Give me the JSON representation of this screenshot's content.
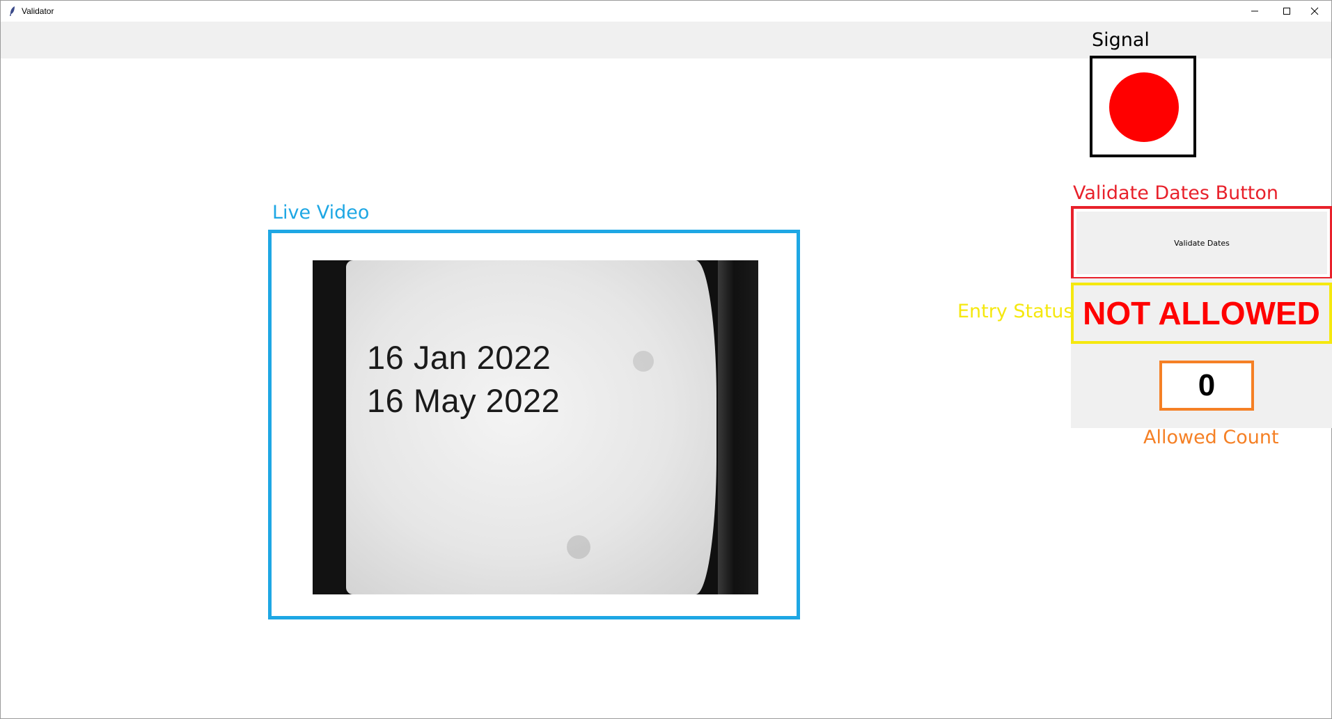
{
  "window": {
    "title": "Validator",
    "minimize_icon": "minimize-icon",
    "maximize_icon": "maximize-icon",
    "close_icon": "close-icon"
  },
  "signal": {
    "label": "Signal",
    "light_color": "#ff0000"
  },
  "video": {
    "label": "Live Video",
    "frame_color": "#1ea7e4",
    "feed_text": [
      "16 Jan 2022",
      "16 May 2022"
    ]
  },
  "validate": {
    "label": "Validate Dates Button",
    "button_label": "Validate Dates",
    "frame_color": "#e8212b"
  },
  "entry_status": {
    "label": "Entry Status",
    "value": "NOT ALLOWED",
    "value_color": "#ff0000",
    "frame_color": "#f5e80f"
  },
  "allowed_count": {
    "label": "Allowed Count",
    "value": "0",
    "frame_color": "#f58025"
  }
}
